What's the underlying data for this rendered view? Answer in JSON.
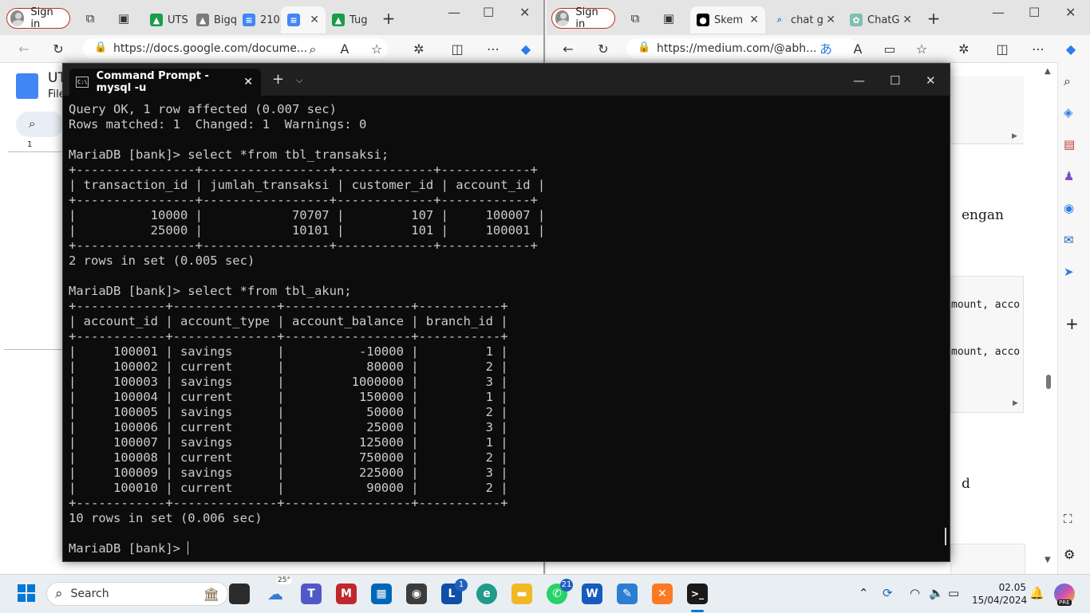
{
  "left_browser": {
    "signin": "Sign in",
    "tabs": [
      {
        "label": "UTS",
        "favicon": "drive-icon"
      },
      {
        "label": "Bigq",
        "favicon": "drive-icon"
      },
      {
        "label": "210",
        "favicon": "docs-icon"
      },
      {
        "label": "",
        "favicon": "docs-icon",
        "active": true
      },
      {
        "label": "Tug",
        "favicon": "drive-icon"
      }
    ],
    "url": "https://docs.google.com/docume...",
    "doc_title": "UT",
    "doc_menu": "File",
    "ruler_mark": "1"
  },
  "right_browser": {
    "signin": "Sign in",
    "tabs": [
      {
        "label": "Skem",
        "favicon": "medium-icon",
        "active": true
      },
      {
        "label": "chat g",
        "favicon": "search-icon"
      },
      {
        "label": "ChatG",
        "favicon": "chatgpt-icon"
      }
    ],
    "url": "https://medium.com/@abh...",
    "page_fragments": [
      "engan",
      "mount, acco",
      "mount, acco",
      "d"
    ]
  },
  "terminal": {
    "tab_title": "Command Prompt - mysql  -u",
    "lines": [
      "Query OK, 1 row affected (0.007 sec)",
      "Rows matched: 1  Changed: 1  Warnings: 0",
      "",
      "MariaDB [bank]> select *from tbl_transaksi;",
      "+----------------+-----------------+-------------+------------+",
      "| transaction_id | jumlah_transaksi | customer_id | account_id |",
      "+----------------+-----------------+-------------+------------+",
      "|          10000 |            70707 |         107 |     100007 |",
      "|          25000 |            10101 |         101 |     100001 |",
      "+----------------+-----------------+-------------+------------+",
      "2 rows in set (0.005 sec)",
      "",
      "MariaDB [bank]> select *from tbl_akun;",
      "+------------+--------------+-----------------+-----------+",
      "| account_id | account_type | account_balance | branch_id |",
      "+------------+--------------+-----------------+-----------+",
      "|     100001 | savings      |          -10000 |         1 |",
      "|     100002 | current      |           80000 |         2 |",
      "|     100003 | savings      |         1000000 |         3 |",
      "|     100004 | current      |          150000 |         1 |",
      "|     100005 | savings      |           50000 |         2 |",
      "|     100006 | current      |           25000 |         3 |",
      "|     100007 | savings      |          125000 |         1 |",
      "|     100008 | current      |          750000 |         2 |",
      "|     100009 | savings      |          225000 |         3 |",
      "|     100010 | current      |           90000 |         2 |",
      "+------------+--------------+-----------------+-----------+",
      "10 rows in set (0.006 sec)",
      "",
      "MariaDB [bank]> "
    ]
  },
  "taskbar": {
    "search_placeholder": "Search",
    "weather_temp": "25°",
    "badges": {
      "l_app": "1",
      "whatsapp": "21"
    },
    "time": "02.05",
    "date": "15/04/2024",
    "copilot_badge": "PRE"
  }
}
